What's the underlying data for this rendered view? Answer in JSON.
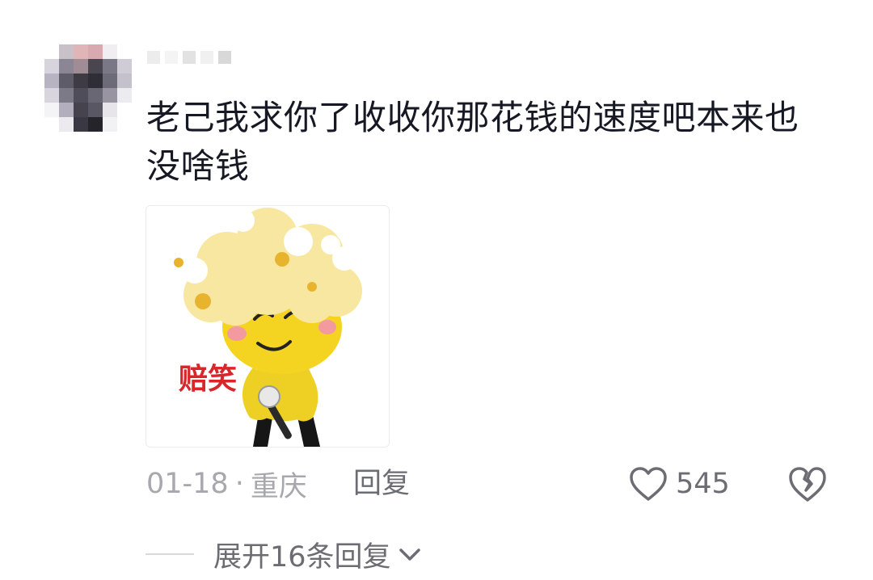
{
  "comment": {
    "text": "老己我求你了收收你那花钱的速度吧本来也没啥钱",
    "sticker": {
      "caption": "赔笑",
      "colors": {
        "hair": "#f8e7a0",
        "face": "#f5d321",
        "body": "#eed024",
        "caption": "#d8262a",
        "legs": "#161616"
      }
    }
  },
  "meta": {
    "date": "01-18",
    "separator": "·",
    "location": "重庆",
    "reply_label": "回复"
  },
  "actions": {
    "like_count": "545",
    "like_icon": "heart-outline-icon",
    "dislike_icon": "broken-heart-icon"
  },
  "replies": {
    "expand_label": "展开16条回复",
    "chevron_icon": "chevron-down-icon"
  },
  "colors": {
    "text_primary": "#161823",
    "text_secondary": "#6b6d73",
    "text_muted": "#a6a8ad",
    "divider": "#d9d9d9"
  }
}
